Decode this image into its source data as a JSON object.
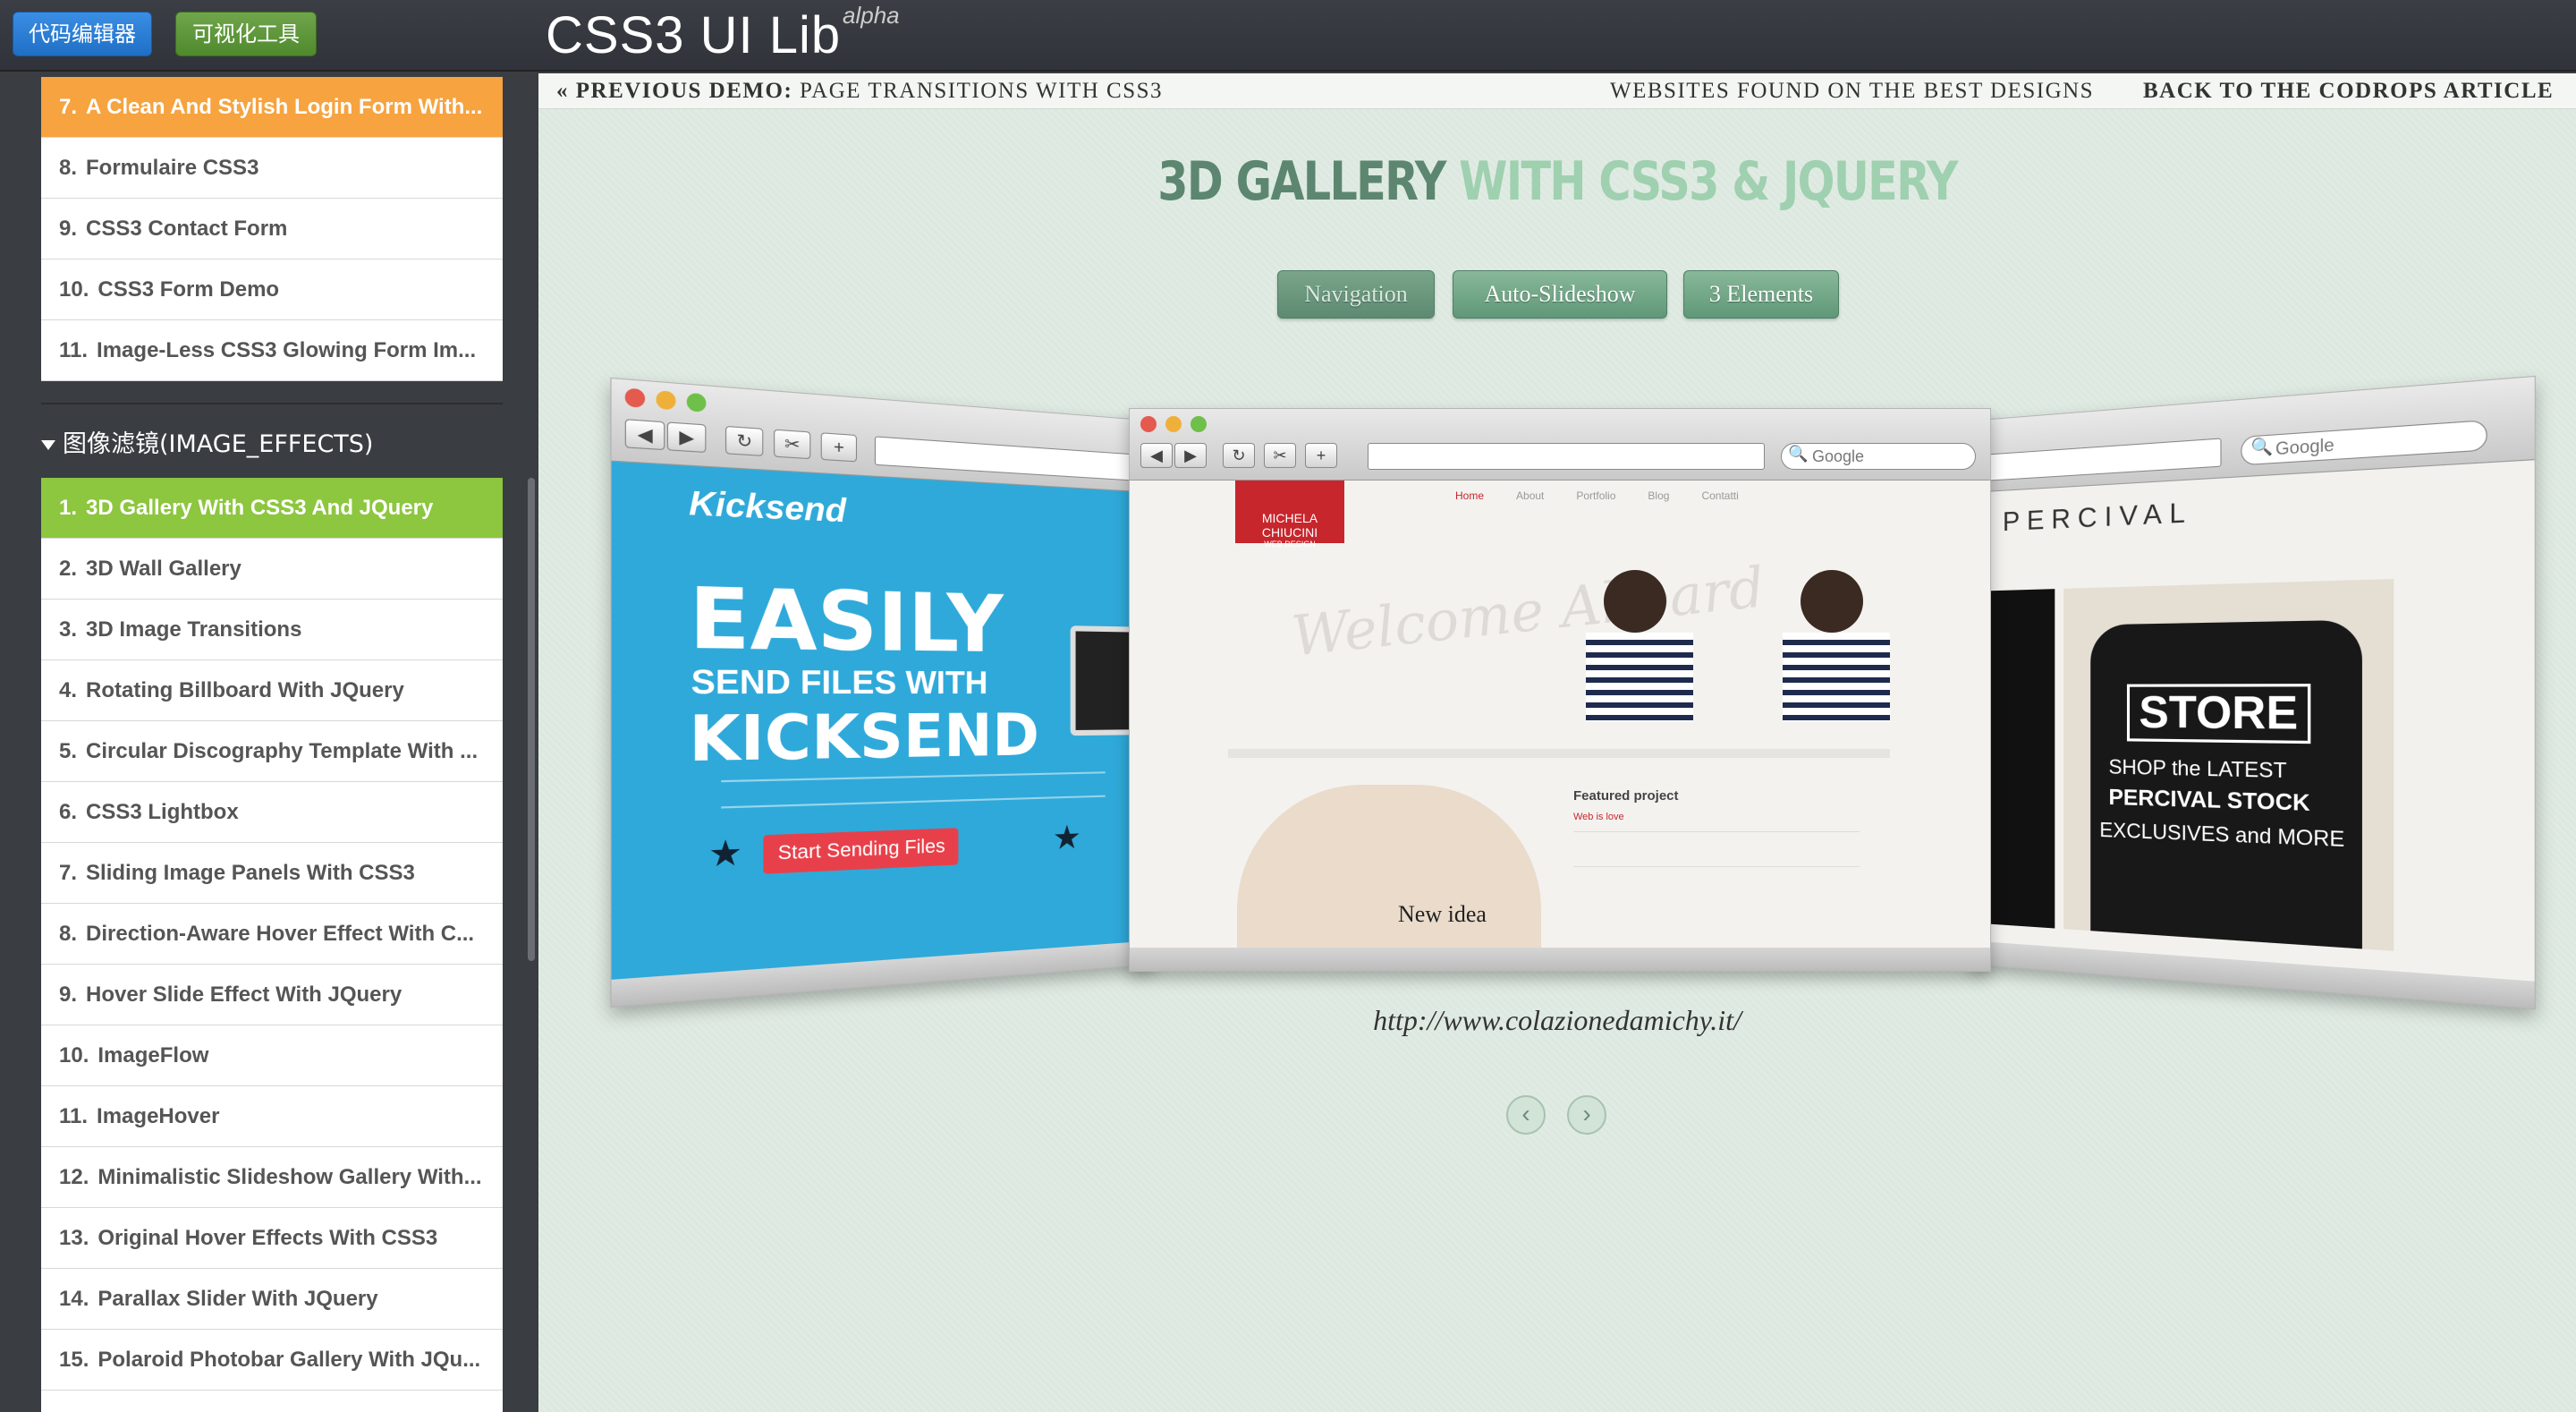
{
  "topbar": {
    "code_editor_button": "代码编辑器",
    "visual_tool_button": "可视化工具",
    "title": "CSS3 UI Lib",
    "badge": "alpha"
  },
  "sidebar": {
    "forms_items": [
      {
        "num": "7.",
        "label": "A Clean And Stylish Login Form With..."
      },
      {
        "num": "8.",
        "label": "Formulaire CSS3"
      },
      {
        "num": "9.",
        "label": "CSS3 Contact Form"
      },
      {
        "num": "10.",
        "label": "CSS3 Form Demo"
      },
      {
        "num": "11.",
        "label": "Image-Less CSS3 Glowing Form Im..."
      }
    ],
    "section_title": "图像滤镜(IMAGE_EFFECTS)",
    "effects_items": [
      {
        "num": "1.",
        "label": "3D Gallery With CSS3 And JQuery"
      },
      {
        "num": "2.",
        "label": "3D Wall Gallery"
      },
      {
        "num": "3.",
        "label": "3D Image Transitions"
      },
      {
        "num": "4.",
        "label": "Rotating Billboard With JQuery"
      },
      {
        "num": "5.",
        "label": "Circular Discography Template With ..."
      },
      {
        "num": "6.",
        "label": "CSS3 Lightbox"
      },
      {
        "num": "7.",
        "label": "Sliding Image Panels With CSS3"
      },
      {
        "num": "8.",
        "label": "Direction-Aware Hover Effect With C..."
      },
      {
        "num": "9.",
        "label": "Hover Slide Effect With JQuery"
      },
      {
        "num": "10.",
        "label": "ImageFlow"
      },
      {
        "num": "11.",
        "label": "ImageHover"
      },
      {
        "num": "12.",
        "label": "Minimalistic Slideshow Gallery With..."
      },
      {
        "num": "13.",
        "label": "Original Hover Effects With CSS3"
      },
      {
        "num": "14.",
        "label": "Parallax Slider With JQuery"
      },
      {
        "num": "15.",
        "label": "Polaroid Photobar Gallery With JQu..."
      }
    ]
  },
  "demo": {
    "prev_label": "« PREVIOUS DEMO:",
    "prev_title": "PAGE TRANSITIONS WITH CSS3",
    "found_link": "WEBSITES FOUND ON THE BEST DESIGNS",
    "back_link": "BACK TO THE CODROPS ARTICLE",
    "title_dark": "3D GALLERY",
    "title_light": "WITH CSS3 & JQUERY",
    "buttons": [
      "Navigation",
      "Auto-Slideshow",
      "3 Elements"
    ],
    "search_placeholder": "Google",
    "caption_url": "http://www.colazionedamichy.it/",
    "left_site": {
      "brand": "Kicksend",
      "headline1": "EASILY",
      "headline2": "SEND FILES WITH",
      "headline3": "KICKSEND",
      "cta": "Start Sending Files"
    },
    "center_site": {
      "logo1": "MICHELA CHIUCINI",
      "logo2": "WEB DESIGN",
      "nav": [
        "Home",
        "About",
        "Portfolio",
        "Blog",
        "Contatti"
      ],
      "watermark": "Welcome Aboard",
      "featured": "Featured project",
      "web_is_love": "Web is love",
      "new_idea": "New idea"
    },
    "right_site": {
      "brand": "PERCIVAL",
      "store": "STORE",
      "line1": "SHOP the LATEST",
      "line2": "PERCIVAL STOCK",
      "line3": "EXCLUSIVES and MORE"
    },
    "colors": {
      "orange_active": "#f6a340",
      "green_active": "#8dc63f",
      "title_dark": "#5c8670",
      "title_light": "#9fd0b0"
    }
  }
}
